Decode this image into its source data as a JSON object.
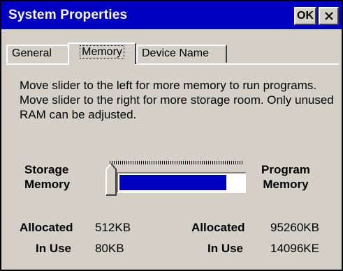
{
  "window": {
    "title": "System Properties",
    "ok_label": "OK"
  },
  "tabs": [
    {
      "label": "General",
      "selected": false
    },
    {
      "label": "Memory",
      "selected": true
    },
    {
      "label": "Device Name",
      "selected": false
    }
  ],
  "memory": {
    "description": "Move slider to the left for more memory to run programs. Move slider to the right for more storage room. Only unused RAM can be adjusted.",
    "storage_label_line1": "Storage",
    "storage_label_line2": "Memory",
    "program_label_line1": "Program",
    "program_label_line2": "Memory",
    "slider_position_fraction": 0.0,
    "program_fill_fraction": 0.85,
    "storage": {
      "allocated_label": "Allocated",
      "allocated_value": "512KB",
      "inuse_label": "In Use",
      "inuse_value": "80KB"
    },
    "program": {
      "allocated_label": "Allocated",
      "allocated_value": "95260KB",
      "inuse_label": "In Use",
      "inuse_value": "14096KE"
    }
  },
  "colors": {
    "titlebar": "#0000c0",
    "progress_fill": "#0000c0",
    "face": "#d4d0c8"
  }
}
